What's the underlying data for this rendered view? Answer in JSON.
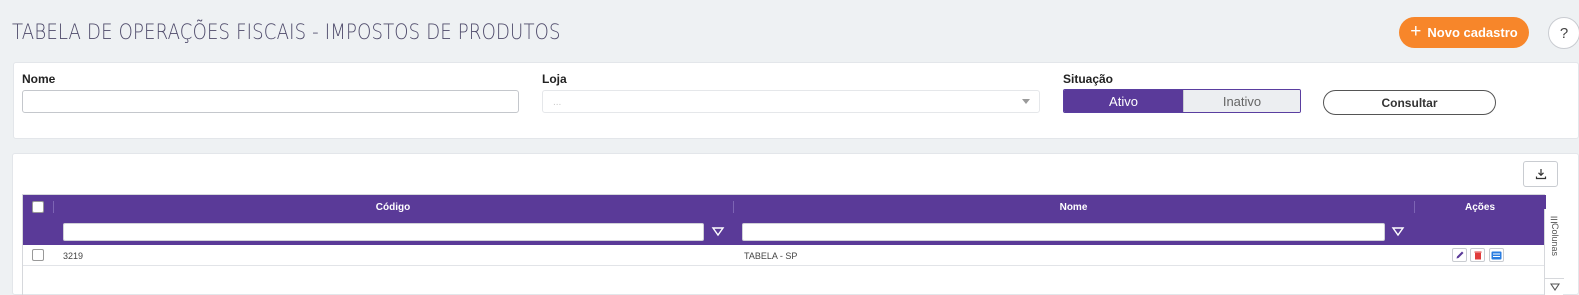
{
  "header": {
    "title": "TABELA DE OPERAÇÕES FISCAIS - IMPOSTOS DE PRODUTOS",
    "new_button_label": "Novo cadastro",
    "help_label": "?"
  },
  "filters": {
    "nome_label": "Nome",
    "nome_value": "",
    "loja_label": "Loja",
    "loja_placeholder": "...",
    "situacao_label": "Situação",
    "situacao_options": [
      "Ativo",
      "Inativo"
    ],
    "situacao_selected": "Ativo",
    "consult_label": "Consultar"
  },
  "grid": {
    "columns": {
      "codigo": "Código",
      "nome": "Nome",
      "acoes": "Ações"
    },
    "rows": [
      {
        "codigo": "3219",
        "nome": "TABELA - SP"
      }
    ],
    "sidebar_columns_label": "Colunas"
  },
  "colors": {
    "accent_purple": "#5a3a98",
    "accent_orange": "#f7862a"
  },
  "icons": [
    "plus-icon",
    "download-icon",
    "filter-icon",
    "edit-icon",
    "delete-icon",
    "detail-icon",
    "columns-menu-icon"
  ]
}
